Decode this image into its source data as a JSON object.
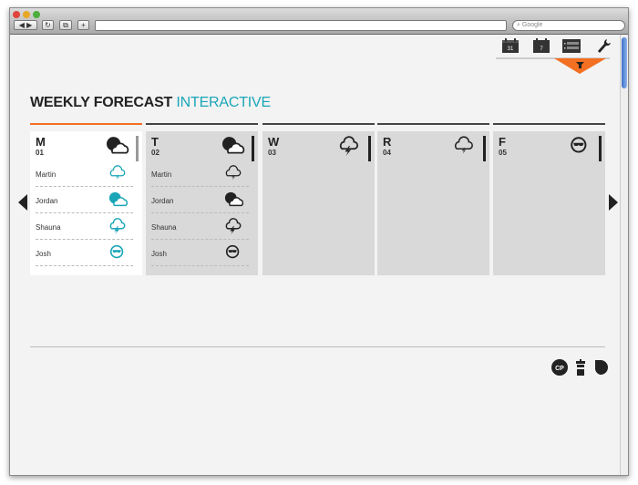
{
  "browser": {
    "search_placeholder": "Google",
    "url": ""
  },
  "toolbar": {
    "icons": [
      {
        "name": "calendar-month-icon",
        "label": "31"
      },
      {
        "name": "calendar-week-icon",
        "label": "7"
      },
      {
        "name": "list-icon"
      },
      {
        "name": "wrench-icon"
      }
    ],
    "filter_icon": "filter-icon",
    "accent": "#f36f21"
  },
  "header": {
    "title": "WEEKLY FORECAST",
    "subtitle": "INTERACTIVE"
  },
  "days": [
    {
      "letter": "M",
      "num": "01",
      "icon": "partly-cloudy",
      "active": true,
      "people": [
        {
          "name": "Martin",
          "icon": "storm-light"
        },
        {
          "name": "Jordan",
          "icon": "partly-cloudy"
        },
        {
          "name": "Shauna",
          "icon": "storm"
        },
        {
          "name": "Josh",
          "icon": "sunglasses"
        }
      ]
    },
    {
      "letter": "T",
      "num": "02",
      "icon": "partly-cloudy",
      "people": [
        {
          "name": "Martin",
          "icon": "storm-light"
        },
        {
          "name": "Jordan",
          "icon": "partly-cloudy"
        },
        {
          "name": "Shauna",
          "icon": "storm"
        },
        {
          "name": "Josh",
          "icon": "sunglasses"
        }
      ]
    },
    {
      "letter": "W",
      "num": "03",
      "icon": "storm",
      "people": []
    },
    {
      "letter": "R",
      "num": "04",
      "icon": "storm-light",
      "people": []
    },
    {
      "letter": "F",
      "num": "05",
      "icon": "sunglasses",
      "people": []
    }
  ],
  "footer": {
    "cp_label": "CP",
    "icons": [
      "cp-icon",
      "trash-icon",
      "drop-icon"
    ]
  },
  "colors": {
    "teal": "#1aa6b7",
    "orange": "#f36f21",
    "dark": "#222222"
  }
}
